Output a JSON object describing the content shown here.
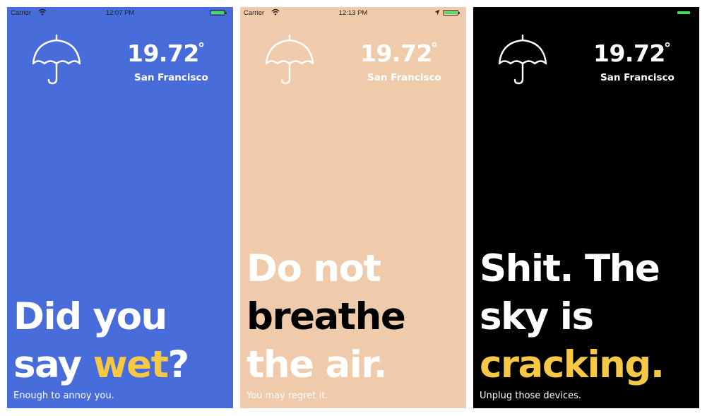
{
  "colors": {
    "blue_bg": "#486ddb",
    "peach_bg": "#efcbac",
    "black_bg": "#000000",
    "yellow_accent": "#f7c846",
    "white": "#ffffff",
    "black": "#000000"
  },
  "screens": [
    {
      "status": {
        "carrier": "Carrier",
        "time": "12:07 PM"
      },
      "weather": {
        "temperature": "19.72",
        "degree": "°",
        "city": "San Francisco"
      },
      "headline": {
        "line1": "Did you",
        "line2_a": "say ",
        "line2_b": "wet",
        "line2_c": "?"
      },
      "subline": "Enough to annoy you."
    },
    {
      "status": {
        "carrier": "Carrier",
        "time": "12:13 PM"
      },
      "weather": {
        "temperature": "19.72",
        "degree": "°",
        "city": "San Francisco"
      },
      "headline": {
        "line1": "Do not",
        "line2": "breathe",
        "line3": "the air."
      },
      "subline": "You may regret it."
    },
    {
      "status": {
        "carrier": "",
        "time": ""
      },
      "weather": {
        "temperature": "19.72",
        "degree": "°",
        "city": "San Francisco"
      },
      "headline": {
        "line1": "Shit. The",
        "line2": "sky is",
        "line3": "cracking."
      },
      "subline": "Unplug those devices."
    }
  ]
}
